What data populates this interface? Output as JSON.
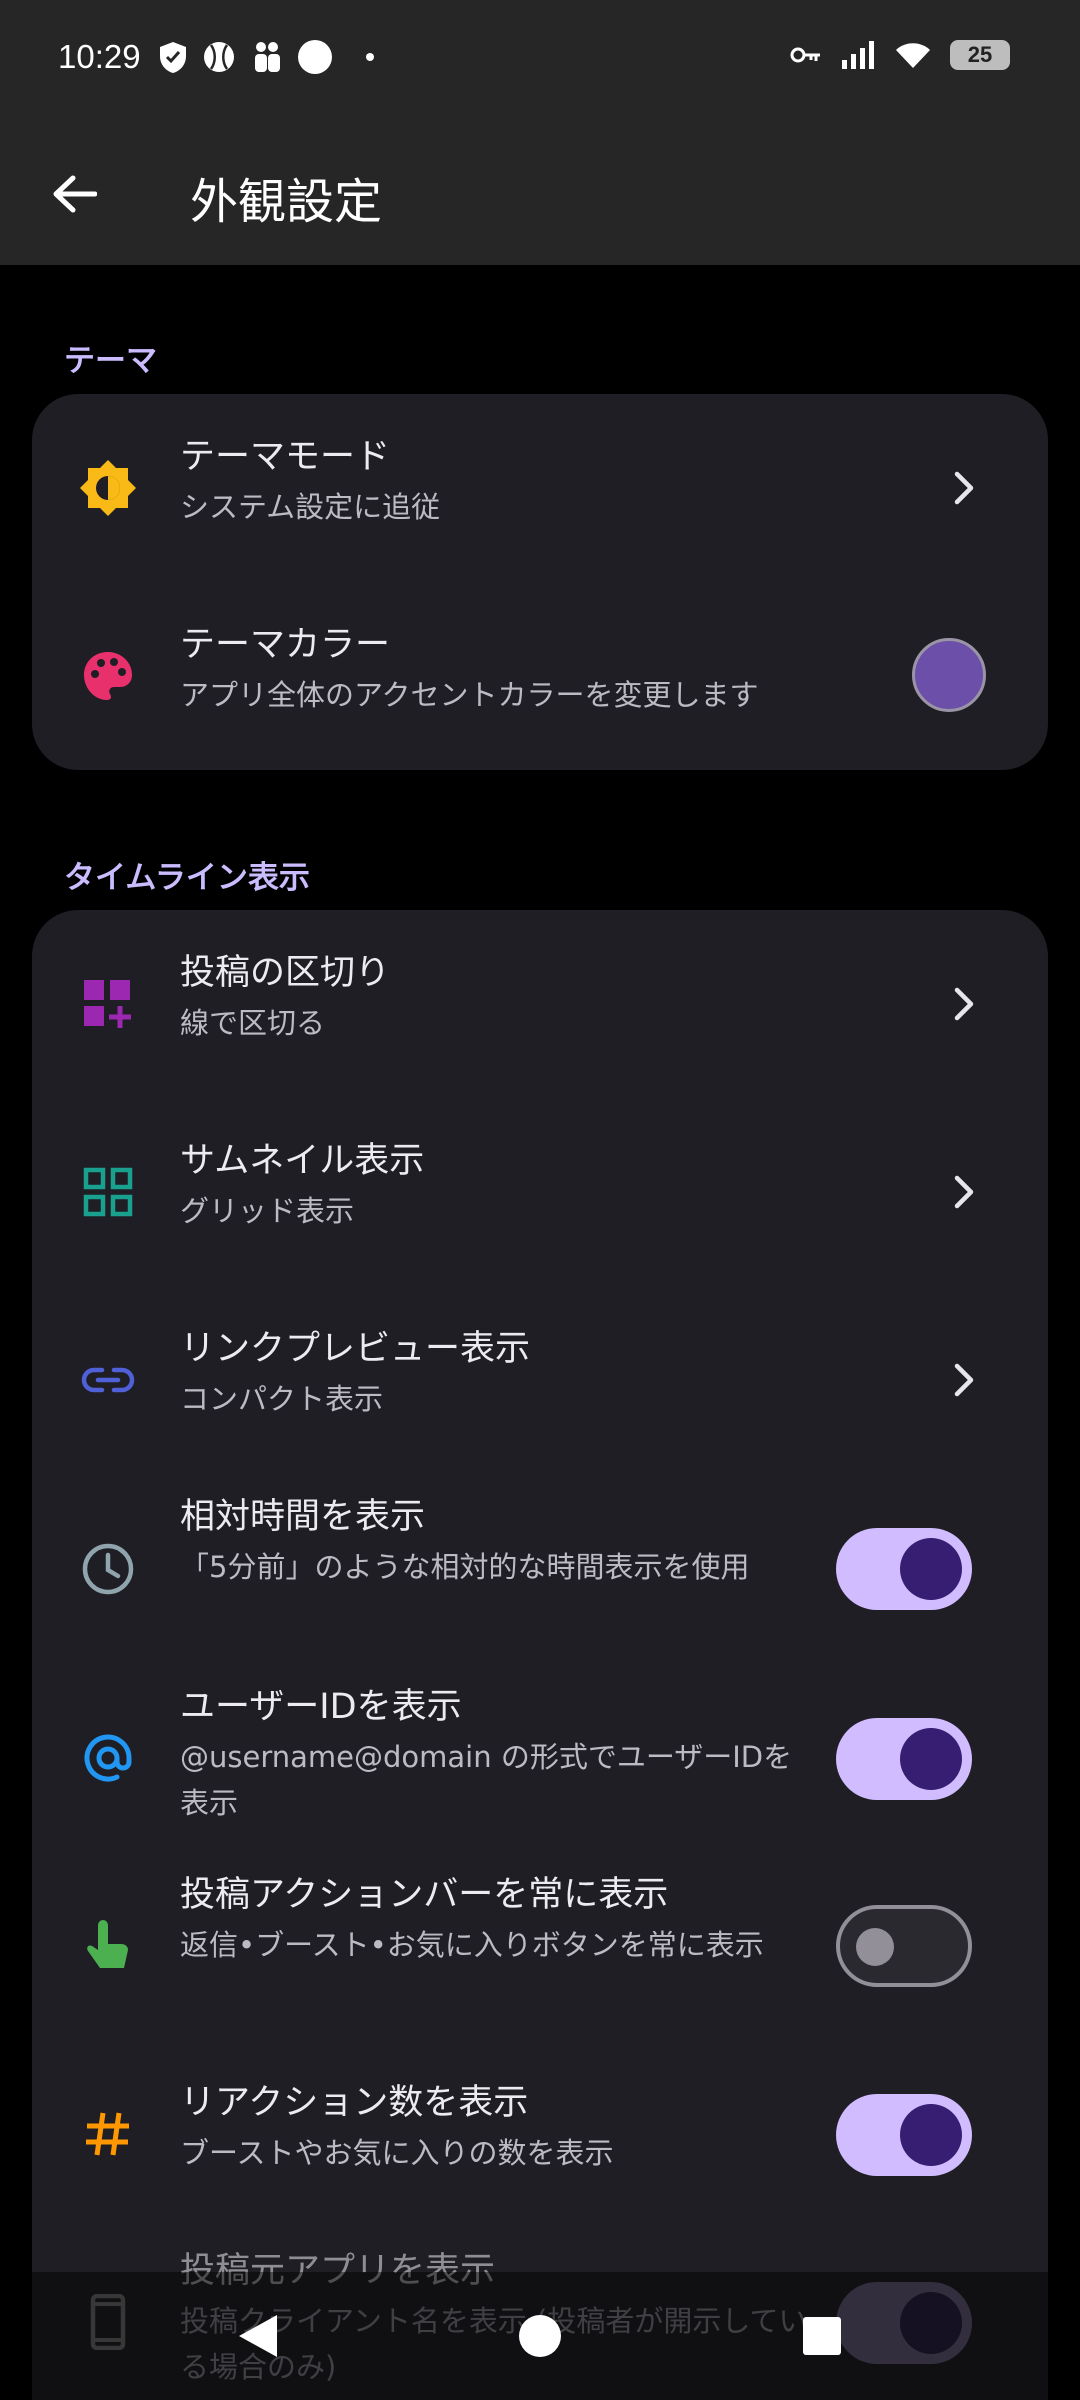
{
  "status_bar": {
    "time": "10:29",
    "battery": "25",
    "left_icons": [
      "shield-icon",
      "baseball-icon",
      "people-icon",
      "circle-icon",
      "dot-icon"
    ],
    "right_icons": [
      "key-icon",
      "signal-icon",
      "wifi-icon",
      "battery-icon"
    ]
  },
  "app_bar": {
    "title": "外観設定",
    "back_icon": "arrow-back-icon"
  },
  "sections": {
    "theme": {
      "header": "テーマ",
      "items": {
        "mode": {
          "title": "テーマモード",
          "subtitle": "システム設定に追従",
          "icon": "brightness-icon",
          "icon_color": "#f9b916"
        },
        "color": {
          "title": "テーマカラー",
          "subtitle": "アプリ全体のアクセントカラーを変更します",
          "icon": "palette-icon",
          "icon_color": "#e8306c",
          "swatch_color": "#6b4fa8"
        }
      }
    },
    "timeline": {
      "header": "タイムライン表示",
      "items": {
        "divider": {
          "title": "投稿の区切り",
          "subtitle": "線で区切る",
          "icon": "dashboard-add-icon",
          "icon_color": "#9c27b0"
        },
        "thumbnail": {
          "title": "サムネイル表示",
          "subtitle": "グリッド表示",
          "icon": "grid-icon",
          "icon_color": "#1aa08e"
        },
        "link_preview": {
          "title": "リンクプレビュー表示",
          "subtitle": "コンパクト表示",
          "icon": "link-icon",
          "icon_color": "#5060d8"
        },
        "relative_time": {
          "title": "相対時間を表示",
          "subtitle": "「5分前」のような相対的な時間表示を使用",
          "icon": "clock-icon",
          "icon_color": "#90a4ae",
          "enabled": true
        },
        "user_id": {
          "title": "ユーザーIDを表示",
          "subtitle": "@username@domain の形式でユーザーIDを表示",
          "icon": "at-sign-icon",
          "icon_color": "#2196f3",
          "enabled": true
        },
        "action_bar": {
          "title": "投稿アクションバーを常に表示",
          "subtitle": "返信•ブースト•お気に入りボタンを常に表示",
          "icon": "touch-icon",
          "icon_color": "#4caf50",
          "enabled": false
        },
        "reaction_count": {
          "title": "リアクション数を表示",
          "subtitle": "ブーストやお気に入りの数を表示",
          "icon": "hash-icon",
          "icon_color": "#ff9800",
          "enabled": true
        },
        "source_app": {
          "title": "投稿元アプリを表示",
          "subtitle": "投稿クライアント名を表示 (投稿者が開示している場合のみ)",
          "icon": "phone-icon",
          "icon_color": "#9e9e9e",
          "enabled": true
        }
      }
    }
  },
  "colors": {
    "accent": "#d0bcff",
    "accent_dark": "#381e72",
    "card": "#1e1e24",
    "header_text": "#cbbcff"
  },
  "nav_bar": {
    "icons": [
      "nav-back-icon",
      "nav-home-icon",
      "nav-recents-icon"
    ]
  }
}
